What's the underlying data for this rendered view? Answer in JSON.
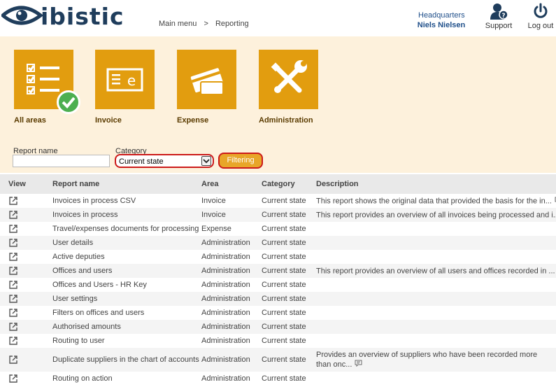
{
  "header": {
    "logo_text": "ibistic",
    "breadcrumb": [
      "Main menu",
      ">",
      "Reporting"
    ],
    "location": "Headquarters",
    "user": "Niels Nielsen",
    "support_label": "Support",
    "logout_label": "Log out"
  },
  "tiles": [
    {
      "label": "All areas",
      "icon": "checklist-icon",
      "selected": true
    },
    {
      "label": "Invoice",
      "icon": "invoice-icon",
      "selected": false
    },
    {
      "label": "Expense",
      "icon": "credit-card-icon",
      "selected": false
    },
    {
      "label": "Administration",
      "icon": "tools-icon",
      "selected": false
    }
  ],
  "filters": {
    "report_name_label": "Report name",
    "report_name_value": "",
    "category_label": "Category",
    "category_value": "Current state",
    "filter_button": "Filtering"
  },
  "table": {
    "columns": [
      "View",
      "Report name",
      "Area",
      "Category",
      "Description"
    ],
    "rows": [
      {
        "name": "Invoices in process CSV",
        "area": "Invoice",
        "category": "Current state",
        "description": "This report shows the original data that provided the basis for the in...",
        "has_comment": true
      },
      {
        "name": "Invoices in process",
        "area": "Invoice",
        "category": "Current state",
        "description": "This report provides an overview of all invoices being processed and i...",
        "has_comment": true
      },
      {
        "name": "Travel/expenses documents for processing",
        "area": "Expense",
        "category": "Current state",
        "description": "",
        "has_comment": false
      },
      {
        "name": "User details",
        "area": "Administration",
        "category": "Current state",
        "description": "",
        "has_comment": false
      },
      {
        "name": "Active deputies",
        "area": "Administration",
        "category": "Current state",
        "description": "",
        "has_comment": false
      },
      {
        "name": "Offices and users",
        "area": "Administration",
        "category": "Current state",
        "description": "This report provides an overview of all users and offices recorded in ...",
        "has_comment": true
      },
      {
        "name": "Offices and Users - HR Key",
        "area": "Administration",
        "category": "Current state",
        "description": "",
        "has_comment": false
      },
      {
        "name": "User settings",
        "area": "Administration",
        "category": "Current state",
        "description": "",
        "has_comment": false
      },
      {
        "name": "Filters on offices and users",
        "area": "Administration",
        "category": "Current state",
        "description": "",
        "has_comment": false
      },
      {
        "name": "Authorised amounts",
        "area": "Administration",
        "category": "Current state",
        "description": "",
        "has_comment": false
      },
      {
        "name": "Routing to user",
        "area": "Administration",
        "category": "Current state",
        "description": "",
        "has_comment": false
      },
      {
        "name": "Duplicate suppliers in the chart of accounts",
        "area": "Administration",
        "category": "Current state",
        "description": "Provides an overview of suppliers who have been recorded more than onc...",
        "has_comment": true
      },
      {
        "name": "Routing on action",
        "area": "Administration",
        "category": "Current state",
        "description": "",
        "has_comment": false
      }
    ]
  },
  "colors": {
    "tile": "#e29d0f",
    "band": "#fdf1dc",
    "brand": "#1f3d5c",
    "highlight": "#cc1a1a"
  }
}
